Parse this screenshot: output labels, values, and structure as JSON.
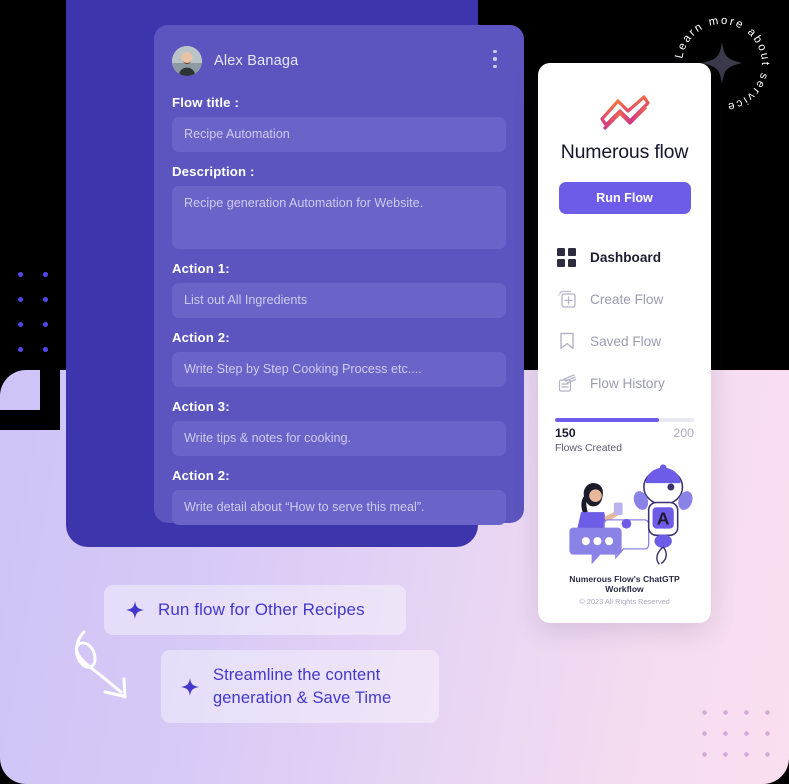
{
  "badge": {
    "text": "Learn more about service ",
    "icon": "sparkle-icon"
  },
  "flow_card": {
    "user": {
      "name": "Alex Banaga",
      "avatar": "user-avatar"
    },
    "menu_icon": "kebab-menu-icon",
    "fields": [
      {
        "label": "Flow title :",
        "value": "Recipe  Automation",
        "tall": false
      },
      {
        "label": "Description :",
        "value": "Recipe generation Automation for Website.",
        "tall": true
      },
      {
        "label": "Action 1:",
        "value": "List out All Ingredients",
        "tall": false
      },
      {
        "label": "Action 2:",
        "value": "Write Step by Step Cooking Process etc....",
        "tall": false
      },
      {
        "label": "Action 3:",
        "value": "Write tips & notes for cooking.",
        "tall": false
      },
      {
        "label": "Action 2:",
        "value": "Write detail about “How to serve this meal”.",
        "tall": false
      }
    ]
  },
  "phone": {
    "brand": "Numerous flow",
    "logo_icon": "numerous-flow-logo",
    "run_button": "Run Flow",
    "menu": [
      {
        "label": "Dashboard",
        "icon": "grid-icon",
        "active": true
      },
      {
        "label": "Create Flow",
        "icon": "add-square-icon",
        "active": false
      },
      {
        "label": "Saved Flow",
        "icon": "bookmark-icon",
        "active": false
      },
      {
        "label": "Flow History",
        "icon": "history-icon",
        "active": false
      }
    ],
    "progress": {
      "current": "150",
      "max": "200",
      "caption": "Flows Created",
      "percent": 75
    },
    "illustration": "chatbot-illustration",
    "footer_title": "Numerous Flow's ChatGTP Workflow",
    "footer_copyright": "© 2023 All Rights Reserved"
  },
  "callouts": [
    {
      "text": "Run flow for Other Recipes",
      "icon": "sparkle-icon"
    },
    {
      "text": "Streamline the content generation & Save Time",
      "icon": "sparkle-icon"
    }
  ],
  "decor": {
    "arrow": "curly-arrow-icon",
    "dots_left": "dot-grid-pattern",
    "dots_right": "dot-grid-pattern"
  },
  "colors": {
    "brand_purple": "#6c5ce7",
    "panel_dark": "#3d35ab",
    "card_purple": "#5c55bf",
    "field_purple": "#6a63c8",
    "accent_text": "#4338ca",
    "logo_gradient_start": "#f98b2a",
    "logo_gradient_end": "#c4279a"
  }
}
